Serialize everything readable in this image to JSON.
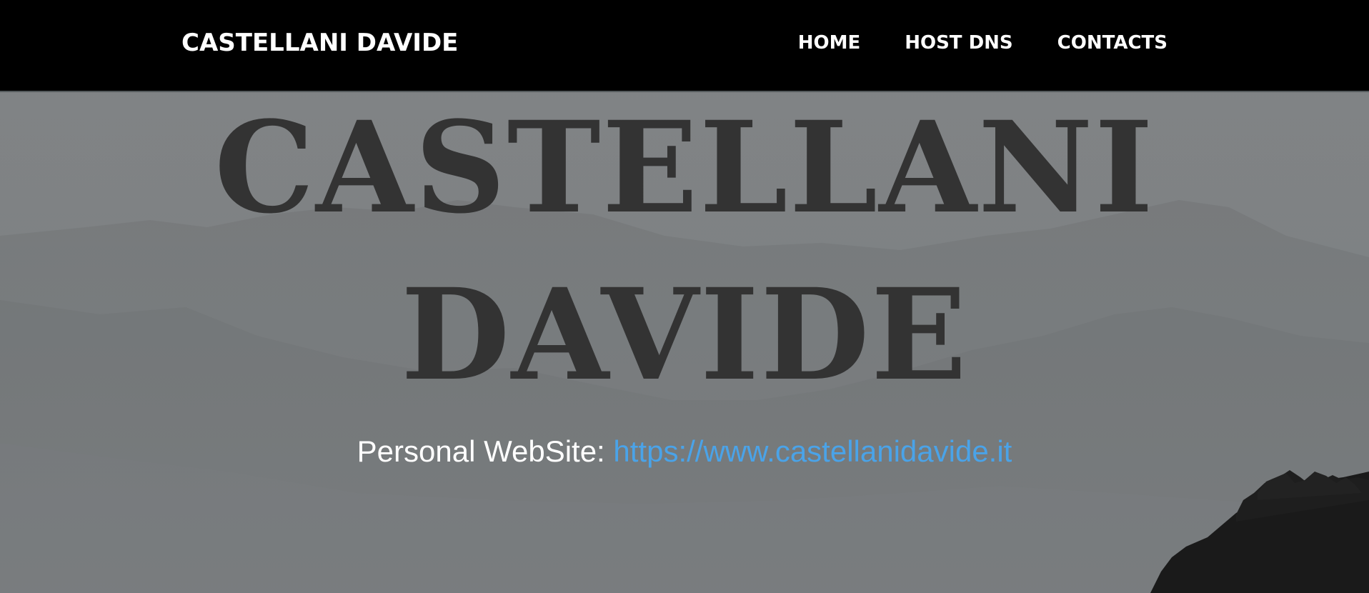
{
  "navbar": {
    "brand": "CASTELLANI DAVIDE",
    "items": [
      {
        "label": "HOME"
      },
      {
        "label": "HOST DNS"
      },
      {
        "label": "CONTACTS"
      }
    ]
  },
  "hero": {
    "title_line1": "CASTELLANI",
    "title_line2": "DAVIDE",
    "subtitle_label": "Personal WebSite:",
    "subtitle_link": "https://www.castellanidavide.it"
  },
  "colors": {
    "navbar_bg": "#000000",
    "title_color": "#333333",
    "link_color": "#4aa3e8"
  }
}
